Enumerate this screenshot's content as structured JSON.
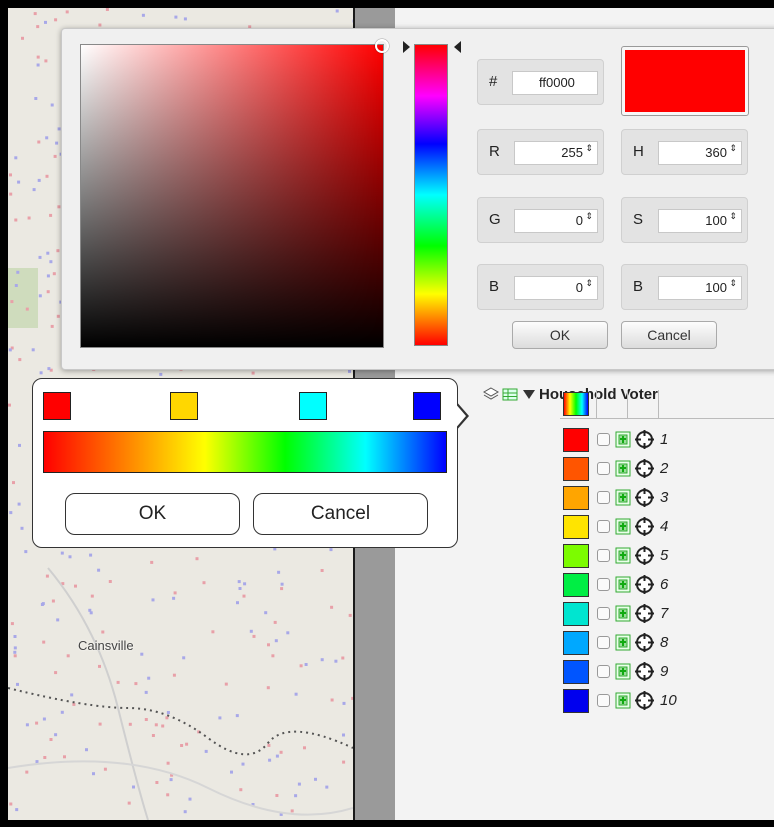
{
  "map": {
    "place_label": "Cainsville"
  },
  "picker": {
    "hex_symbol": "#",
    "hex_value": "ff0000",
    "preview_color": "#ff0000",
    "fields": [
      {
        "label": "R",
        "value": "255"
      },
      {
        "label": "H",
        "value": "360"
      },
      {
        "label": "G",
        "value": "0"
      },
      {
        "label": "S",
        "value": "100"
      },
      {
        "label": "B",
        "value": "0"
      },
      {
        "label": "B",
        "value": "100"
      }
    ],
    "spinner_glyph": "⇕",
    "ok_label": "OK",
    "cancel_label": "Cancel"
  },
  "spectrum": {
    "stops": [
      "#ff0000",
      "#ffd700",
      "#00ffff",
      "#0000ff"
    ],
    "gradient_colors": [
      "#ff0000",
      "#ff8000",
      "#ffff00",
      "#00ff00",
      "#00ffff",
      "#0000ff"
    ],
    "ok_label": "OK",
    "cancel_label": "Cancel"
  },
  "layer": {
    "title": "Household Voter",
    "partial_text_1": "i",
    "partial_text_2": "h",
    "classes": [
      {
        "color": "#ff0000",
        "label": "1"
      },
      {
        "color": "#ff5500",
        "label": "2"
      },
      {
        "color": "#ffa500",
        "label": "3"
      },
      {
        "color": "#ffe400",
        "label": "4"
      },
      {
        "color": "#7cfc00",
        "label": "5"
      },
      {
        "color": "#00ee44",
        "label": "6"
      },
      {
        "color": "#00e5d0",
        "label": "7"
      },
      {
        "color": "#00a8ff",
        "label": "8"
      },
      {
        "color": "#0055ff",
        "label": "9"
      },
      {
        "color": "#0000ee",
        "label": "10"
      }
    ]
  }
}
